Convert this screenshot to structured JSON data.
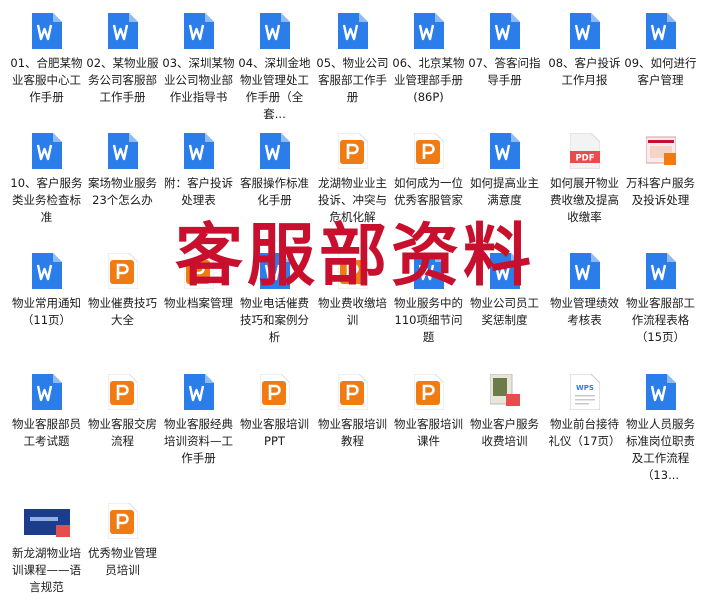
{
  "watermark": "客服部资料",
  "files": [
    {
      "type": "word",
      "label": "01、合肥某物业客服中心工作手册"
    },
    {
      "type": "word",
      "label": "02、某物业服务公司客服部工作手册"
    },
    {
      "type": "word",
      "label": "03、深圳某物业公司物业部作业指导书"
    },
    {
      "type": "word",
      "label": "04、深圳金地物业管理处工作手册（全套..."
    },
    {
      "type": "word",
      "label": "05、物业公司客服部工作手册"
    },
    {
      "type": "word",
      "label": "06、北京某物业管理部手册(86P)"
    },
    {
      "type": "word",
      "label": "07、答客问指导手册"
    },
    {
      "type": "word",
      "label": "08、客户投诉工作月报"
    },
    {
      "type": "word",
      "label": "09、如何进行客户管理"
    },
    {
      "type": "word",
      "label": "10、客户服务类业务检查标准"
    },
    {
      "type": "word",
      "label": "案场物业服务23个怎么办"
    },
    {
      "type": "word",
      "label": "附：客户投诉处理表"
    },
    {
      "type": "word",
      "label": "客服操作标准化手册"
    },
    {
      "type": "ppt",
      "label": "龙湖物业业主投诉、冲突与危机化解"
    },
    {
      "type": "ppt",
      "label": "如何成为一位优秀客服管家"
    },
    {
      "type": "word",
      "label": "如何提高业主满意度"
    },
    {
      "type": "pdf",
      "label": "如何展开物业费收缴及提高收缴率"
    },
    {
      "type": "thumb",
      "label": "万科客户服务及投诉处理"
    },
    {
      "type": "word",
      "label": "物业常用通知（11页）"
    },
    {
      "type": "ppt",
      "label": "物业催费技巧大全"
    },
    {
      "type": "ppt",
      "label": "物业档案管理"
    },
    {
      "type": "word",
      "label": "物业电话催费技巧和案例分析"
    },
    {
      "type": "ppt",
      "label": "物业费收缴培训"
    },
    {
      "type": "word",
      "label": "物业服务中的110项细节问题"
    },
    {
      "type": "word",
      "label": "物业公司员工奖惩制度"
    },
    {
      "type": "word",
      "label": "物业管理绩效考核表"
    },
    {
      "type": "word",
      "label": "物业客服部工作流程表格（15页）"
    },
    {
      "type": "word",
      "label": "物业客服部员工考试题"
    },
    {
      "type": "ppt",
      "label": "物业客服交房流程"
    },
    {
      "type": "word",
      "label": "物业客服经典培训资料—工作手册"
    },
    {
      "type": "ppt",
      "label": "物业客服培训PPT"
    },
    {
      "type": "ppt",
      "label": "物业客服培训教程"
    },
    {
      "type": "ppt",
      "label": "物业客服培训课件"
    },
    {
      "type": "thumb2",
      "label": "物业客户服务收费培训"
    },
    {
      "type": "wps",
      "label": "物业前台接待礼仪（17页）"
    },
    {
      "type": "word",
      "label": "物业人员服务标准岗位职责及工作流程（13..."
    },
    {
      "type": "thumb3",
      "label": "新龙湖物业培训课程——语言规范"
    },
    {
      "type": "ppt",
      "label": "优秀物业管理员培训"
    }
  ]
}
